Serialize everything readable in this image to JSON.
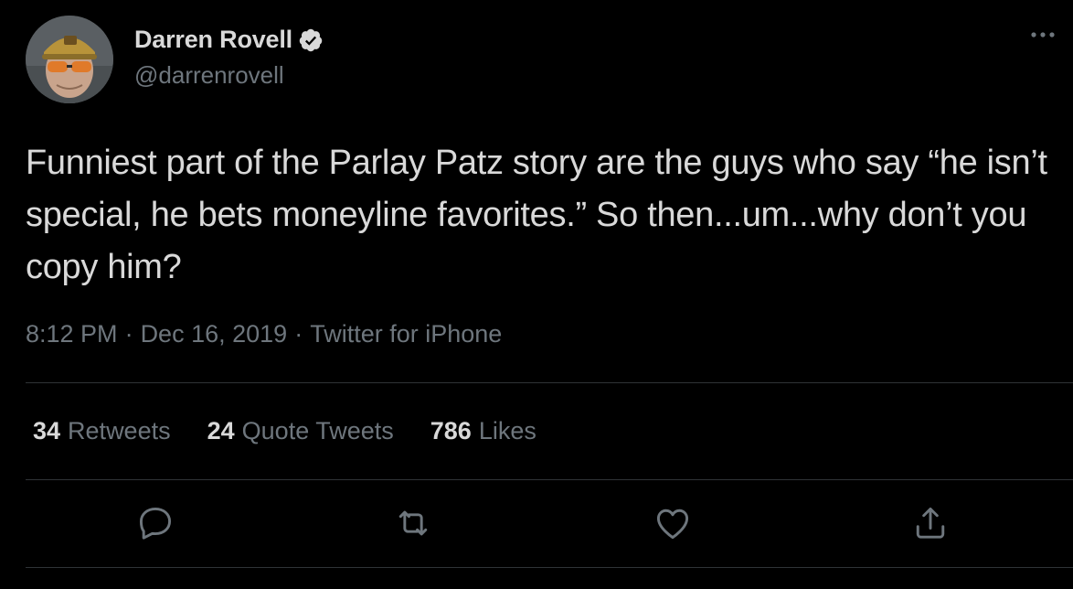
{
  "user": {
    "display_name": "Darren Rovell",
    "handle": "@darrenrovell",
    "verified": true,
    "avatar_icon": "profile-photo"
  },
  "tweet": {
    "text": "Funniest part of the Parlay Patz story are the guys who say “he isn’t special, he bets moneyline favorites.” So then...um...why don’t you copy him?",
    "time": "8:12 PM",
    "date": "Dec 16, 2019",
    "source": "Twitter for iPhone",
    "separator": "·"
  },
  "stats": {
    "retweets_count": "34",
    "retweets_label": "Retweets",
    "quotes_count": "24",
    "quotes_label": "Quote Tweets",
    "likes_count": "786",
    "likes_label": "Likes"
  },
  "actions": {
    "reply_icon": "reply-icon",
    "retweet_icon": "retweet-icon",
    "like_icon": "heart-icon",
    "share_icon": "share-icon"
  },
  "colors": {
    "background": "#000000",
    "primary_text": "#d9d9d9",
    "secondary_text": "#6e767d",
    "divider": "#2f3336",
    "verified_badge": "#d9d9d9"
  }
}
